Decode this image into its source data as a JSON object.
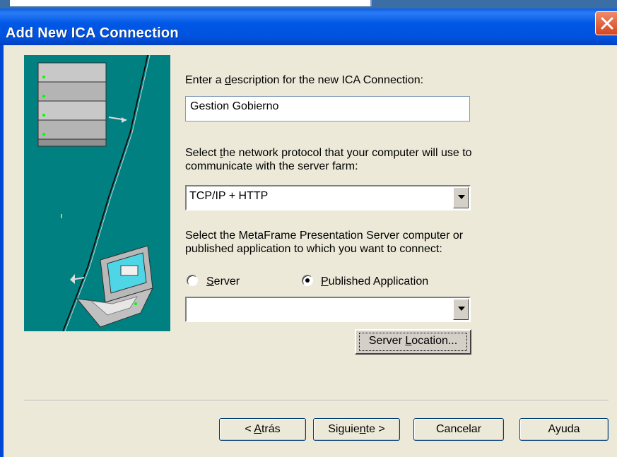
{
  "window": {
    "title": "Add New ICA Connection"
  },
  "description": {
    "prompt_pre": "Enter a ",
    "prompt_accel": "d",
    "prompt_post": "escription for the new ICA Connection:",
    "value": "Gestion Gobierno"
  },
  "protocol": {
    "prompt_line1_pre": "Select ",
    "prompt_line1_accel": "t",
    "prompt_line1_post": "he network protocol that your computer will use to",
    "prompt_line2": "communicate with the server farm:",
    "selected": "TCP/IP + HTTP"
  },
  "server": {
    "prompt_line1": "Select the MetaFrame Presentation Server computer or",
    "prompt_line2": "published application to which you want to connect:",
    "radio_server_accel": "S",
    "radio_server_rest": "erver",
    "radio_published_accel": "P",
    "radio_published_rest": "ublished Application",
    "selected_mode": "Published Application",
    "application_value": "",
    "location_pre": "Server ",
    "location_accel": "L",
    "location_post": "ocation..."
  },
  "buttons": {
    "back_pre": "< ",
    "back_accel": "A",
    "back_post": "trás",
    "next_pre": "Siguie",
    "next_accel": "n",
    "next_post": "te >",
    "cancel": "Cancelar",
    "help": "Ayuda"
  },
  "colors": {
    "titlebar": "#0052dd",
    "panel": "#008080",
    "dialog_bg": "#ece9d8"
  }
}
